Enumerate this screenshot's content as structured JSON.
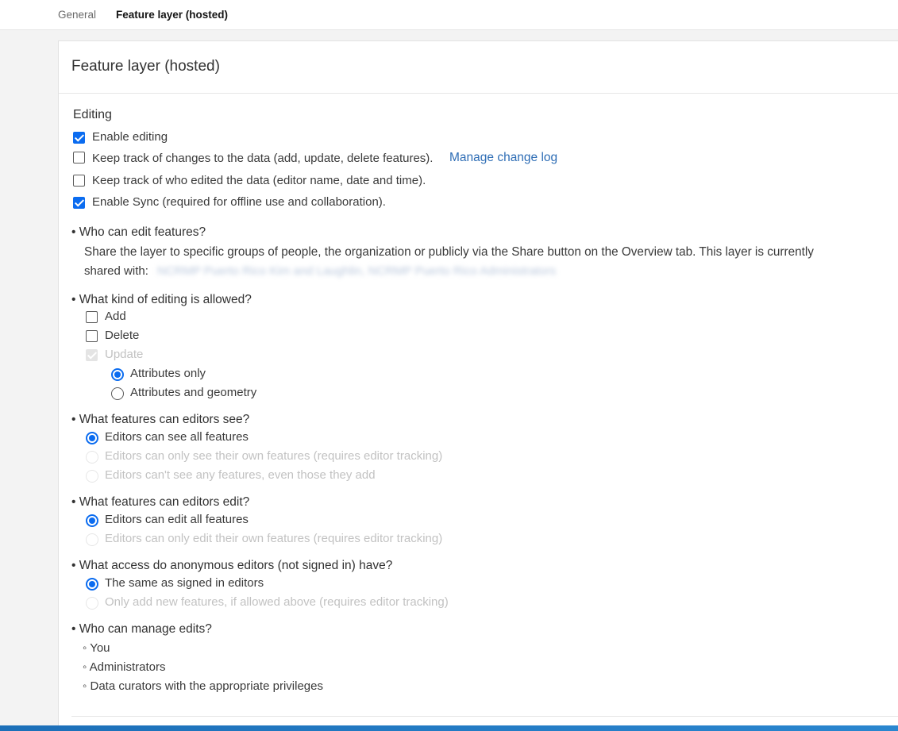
{
  "tabs": {
    "general": "General",
    "feature_layer": "Feature layer (hosted)"
  },
  "panel": {
    "title": "Feature layer (hosted)"
  },
  "editing": {
    "heading": "Editing",
    "enable_editing": {
      "label": "Enable editing",
      "checked": true
    },
    "track_changes": {
      "label": "Keep track of changes to the data (add, update, delete features).",
      "checked": false
    },
    "manage_change_log": "Manage change log",
    "track_editors": {
      "label": "Keep track of who edited the data (editor name, date and time).",
      "checked": false
    },
    "enable_sync": {
      "label": "Enable Sync (required for offline use and collaboration).",
      "checked": true
    }
  },
  "who_can_edit": {
    "title": "• Who can edit features?",
    "line1": "Share the layer to specific groups of people, the organization or publicly via the Share button on the Overview tab. This layer is currently",
    "line2_prefix": "shared with:",
    "shared_with_redacted": "NCRMP Puerto Rico Kim and Laughlin, NCRMP Puerto Rico Administrators"
  },
  "kind_of_editing": {
    "title": "• What kind of editing is allowed?",
    "add": "Add",
    "delete": "Delete",
    "update": "Update",
    "attributes_only": "Attributes only",
    "attributes_and_geometry": "Attributes and geometry"
  },
  "editors_see": {
    "title": "• What features can editors see?",
    "all": "Editors can see all features",
    "own": "Editors can only see their own features (requires editor tracking)",
    "none": "Editors can't see any features, even those they add"
  },
  "editors_edit": {
    "title": "• What features can editors edit?",
    "all": "Editors can edit all features",
    "own": "Editors can only edit their own features (requires editor tracking)"
  },
  "anonymous": {
    "title": "• What access do anonymous editors (not signed in) have?",
    "same": "The same as signed in editors",
    "add_only": "Only add new features, if allowed above (requires editor tracking)"
  },
  "manage_edits": {
    "title": "• Who can manage edits?",
    "you": "◦ You",
    "admins": "◦ Administrators",
    "curators": "◦ Data curators with the appropriate privileges"
  }
}
